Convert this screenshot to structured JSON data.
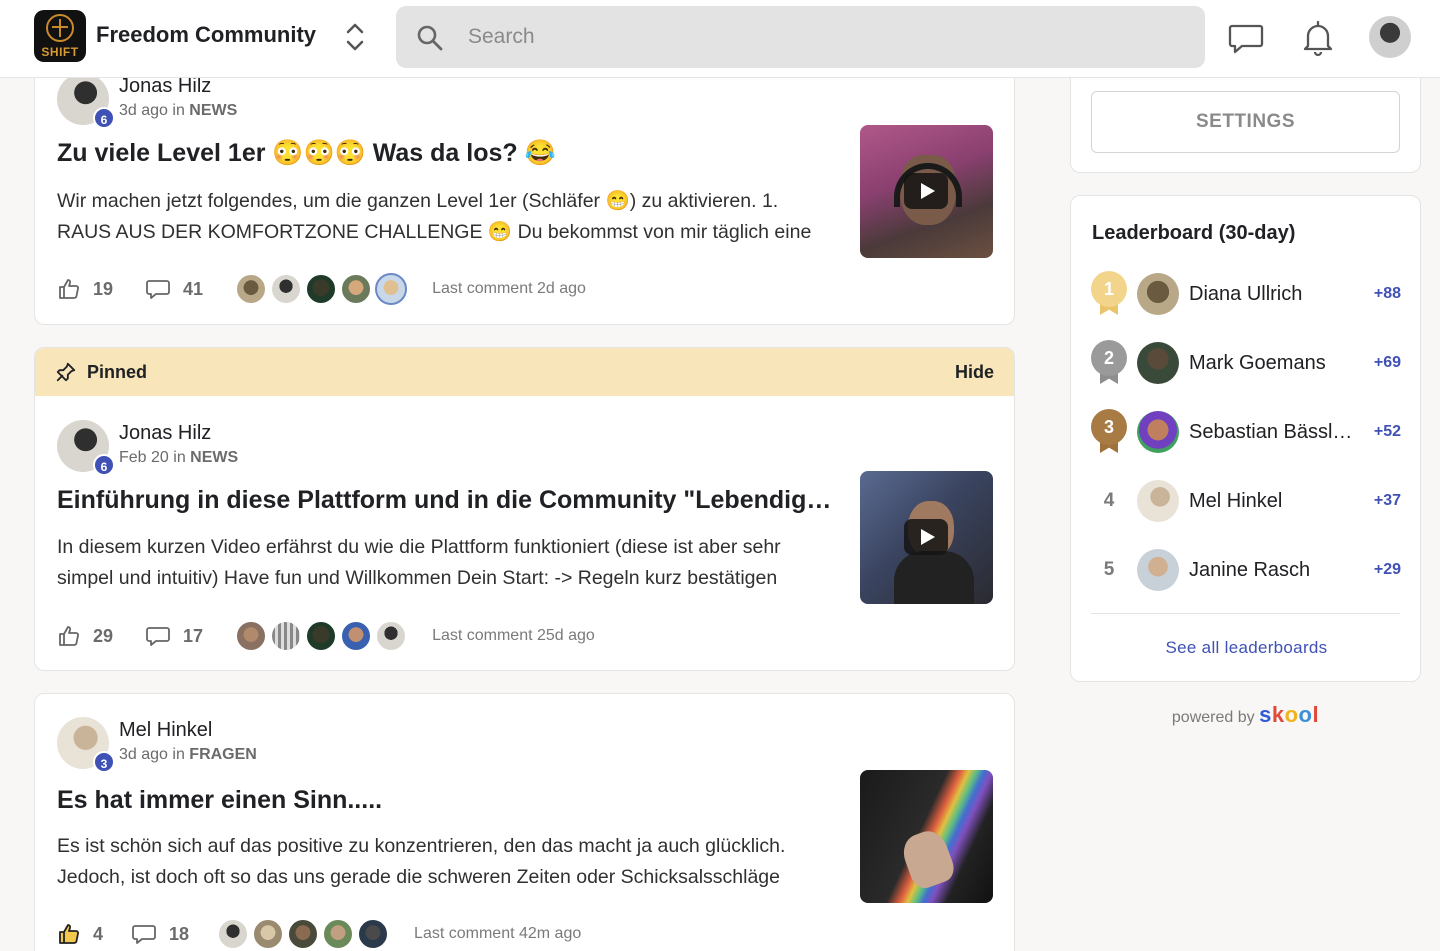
{
  "header": {
    "logo_text": "SHIFT",
    "group_name": "Freedom Community",
    "search_placeholder": "Search"
  },
  "feed": {
    "posts": [
      {
        "author": "Jonas Hilz",
        "level": "6",
        "time": "3d ago",
        "in_word": "in",
        "category": "NEWS",
        "title": "Zu viele Level 1er 😳😳😳 Was da los? 😂",
        "excerpt": "Wir machen jetzt folgendes, um die ganzen Level 1er (Schläfer 😁) zu aktivieren. 1. RAUS AUS DER KOMFORTZONE CHALLENGE 😁 Du bekommst von mir täglich eine",
        "likes": "19",
        "comments": "41",
        "last_comment": "Last comment 2d ago"
      },
      {
        "pinned_label": "Pinned",
        "hide_label": "Hide",
        "author": "Jonas Hilz",
        "level": "6",
        "time": "Feb 20",
        "in_word": "in",
        "category": "NEWS",
        "title": "Einführung in diese Plattform und in die Community \"Lebendigkeit…",
        "excerpt": "In diesem kurzen Video erfährst du wie die Plattform funktioniert (diese ist aber sehr simpel und intuitiv) Have fun und Willkommen Dein Start: -> Regeln kurz bestätigen",
        "likes": "29",
        "comments": "17",
        "last_comment": "Last comment 25d ago"
      },
      {
        "author": "Mel Hinkel",
        "level": "3",
        "time": "3d ago",
        "in_word": "in",
        "category": "FRAGEN",
        "title": "Es hat immer einen Sinn.....",
        "excerpt": "Es ist schön sich auf das positive zu konzentrieren, den das macht ja auch glücklich. Jedoch, ist doch oft so das uns gerade die schweren Zeiten oder Schicksalsschläge",
        "likes": "4",
        "comments": "18",
        "last_comment": "Last comment 42m ago"
      }
    ]
  },
  "sidebar": {
    "settings_label": "SETTINGS",
    "leaderboard_title": "Leaderboard (30-day)",
    "leaders": [
      {
        "rank": "1",
        "name": "Diana Ullrich",
        "points": "+88"
      },
      {
        "rank": "2",
        "name": "Mark Goemans",
        "points": "+69"
      },
      {
        "rank": "3",
        "name": "Sebastian Bässl…",
        "points": "+52"
      },
      {
        "rank": "4",
        "name": "Mel Hinkel",
        "points": "+37"
      },
      {
        "rank": "5",
        "name": "Janine Rasch",
        "points": "+29"
      }
    ],
    "see_all": "See all leaderboards",
    "powered_by": "powered by",
    "brand": "skool"
  },
  "colors": {
    "accent": "#3f51b5",
    "pinned_bg": "#f8e6ba",
    "gold": "#e9c46a",
    "silver": "#8e8e8e",
    "bronze": "#a0713a"
  },
  "icons": [
    "search-icon",
    "chat-icon",
    "bell-icon",
    "thumbs-up-icon",
    "comment-icon",
    "pin-icon",
    "chevron-updown-icon",
    "play-icon"
  ]
}
